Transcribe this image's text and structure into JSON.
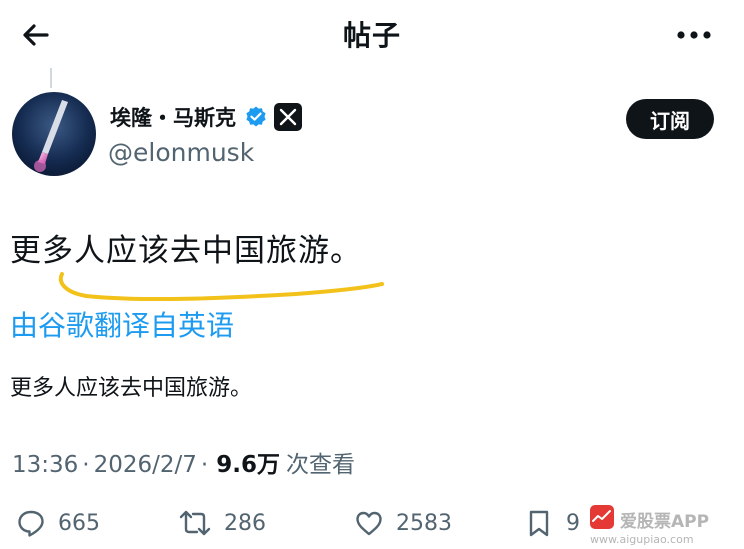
{
  "header": {
    "title": "帖子",
    "back_icon": "arrow-left-icon",
    "more_icon": "more-horizontal-icon"
  },
  "author": {
    "name": "埃隆・马斯克",
    "handle": "@elonmusk",
    "verified_icon": "verified-badge-icon",
    "affiliation_icon": "x-logo-icon",
    "subscribe_label": "订阅"
  },
  "post": {
    "text": "更多人应该去中国旅游。",
    "translate_link": "由谷歌翻译自英语",
    "translated_text": "更多人应该去中国旅游。"
  },
  "meta": {
    "time": "13:36",
    "separator": "·",
    "date": "2026/2/7",
    "views": "9.6万",
    "views_label": "次查看"
  },
  "actions": {
    "replies": "665",
    "reposts": "286",
    "likes": "2583",
    "bookmarks": "9"
  },
  "watermark": {
    "text": "爱股票APP",
    "url": "www.aigupiao.com"
  },
  "colors": {
    "accent": "#1d9bf0",
    "text_primary": "#0f1419",
    "text_secondary": "#536471",
    "underline": "#f2c21b"
  }
}
